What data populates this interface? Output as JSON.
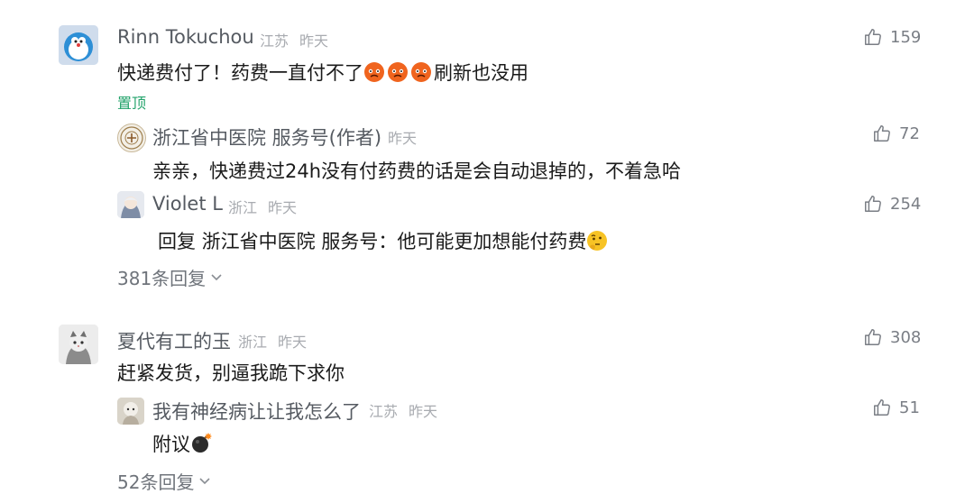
{
  "colors": {
    "pinned": "#23a36b",
    "meta": "#a8abb0",
    "name": "#555a61",
    "text": "#1a1a1a"
  },
  "comments": [
    {
      "name": "Rinn Tokuchou",
      "location": "江苏",
      "time": "昨天",
      "likes": "159",
      "text_before": "快递费付了！药费一直付不了",
      "emoji": "angry-face-x3",
      "text_after": "刷新也没用",
      "badge": "置顶",
      "replies": [
        {
          "name": "浙江省中医院 服务号(作者)",
          "time": "昨天",
          "likes": "72",
          "text": "亲亲，快递费过24h没有付药费的话是会自动退掉的，不着急哈"
        },
        {
          "name": "Violet L",
          "location": "浙江",
          "time": "昨天",
          "likes": "254",
          "text": "回复 浙江省中医院 服务号：他可能更加想能付药费",
          "emoji": "thinking-face"
        }
      ],
      "more_replies": "381条回复"
    },
    {
      "name": "夏代有工的玉",
      "location": "浙江",
      "time": "昨天",
      "likes": "308",
      "text": "赶紧发货，别逼我跪下求你",
      "replies": [
        {
          "name": "我有神经病让让我怎么了",
          "location": "江苏",
          "time": "昨天",
          "likes": "51",
          "text": "附议",
          "emoji": "bomb"
        }
      ],
      "more_replies": "52条回复"
    }
  ]
}
